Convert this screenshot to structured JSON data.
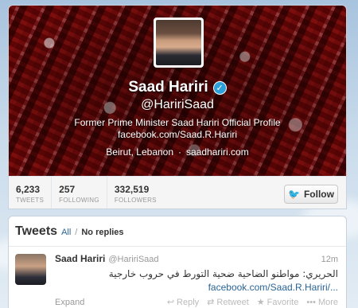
{
  "profile": {
    "name": "Saad Hariri",
    "verified_icon": "verified-check-icon",
    "handle": "@HaririSaad",
    "bio": "Former Prime Minister Saad Hariri Official Profile",
    "facebook": "facebook.com/Saad.R.Hariri",
    "location": "Beirut, Lebanon",
    "location_sep": "·",
    "website": "saadhariri.com",
    "accent_color": "#2d9fd9"
  },
  "stats": [
    {
      "value": "6,233",
      "label": "TWEETS"
    },
    {
      "value": "257",
      "label": "FOLLOWING"
    },
    {
      "value": "332,519",
      "label": "FOLLOWERS"
    }
  ],
  "follow_button": {
    "label": "Follow",
    "icon": "bird-icon"
  },
  "tweets_section": {
    "title": "Tweets",
    "filter_all": "All",
    "filter_sep": "/",
    "filter_noreplies": "No replies"
  },
  "tweet": {
    "name": "Saad Hariri",
    "handle": "@HaririSaad",
    "time": "12m",
    "text": "الحريري: مواطنو الضاحية ضحية التورط في حروب خارجية",
    "link": "facebook.com/Saad.R.Hariri/...",
    "expand": "Expand",
    "actions": [
      {
        "label": "Reply",
        "icon": "reply-icon"
      },
      {
        "label": "Retweet",
        "icon": "retweet-icon"
      },
      {
        "label": "Favorite",
        "icon": "star-icon"
      },
      {
        "label": "More",
        "icon": "more-icon"
      }
    ]
  }
}
